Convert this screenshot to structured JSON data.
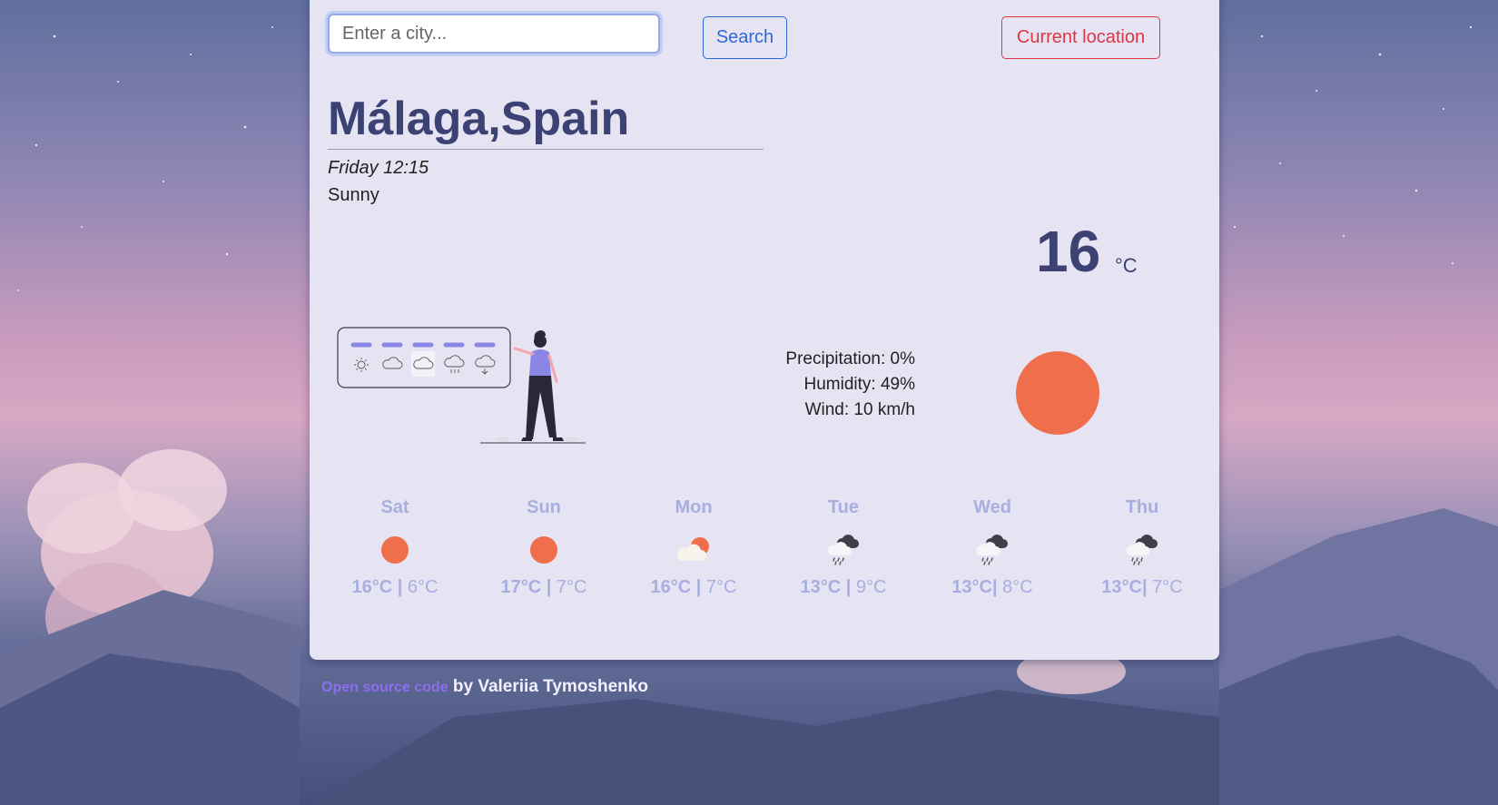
{
  "search": {
    "placeholder": "Enter a city...",
    "search_label": "Search",
    "location_label": "Current location"
  },
  "current": {
    "city": "Málaga,Spain",
    "datetime": "Friday 12:15",
    "description": "Sunny",
    "temperature": "16",
    "unit": "°C",
    "icon": "sun-icon",
    "details": {
      "precipitation": "Precipitation: 0%",
      "humidity": "Humidity: 49%",
      "wind": "Wind: 10 km/h"
    }
  },
  "forecast": [
    {
      "day": "Sat",
      "max": "16°C",
      "sep": " | ",
      "min": "6°C",
      "icon": "sun-icon"
    },
    {
      "day": "Sun",
      "max": "17°C",
      "sep": " | ",
      "min": "7°C",
      "icon": "sun-icon"
    },
    {
      "day": "Mon",
      "max": "16°C",
      "sep": " | ",
      "min": "7°C",
      "icon": "partly-cloudy-icon"
    },
    {
      "day": "Tue",
      "max": "13°C",
      "sep": " | ",
      "min": "9°C",
      "icon": "rain-cloud-icon"
    },
    {
      "day": "Wed",
      "max": "13°C",
      "sep": "| ",
      "min": "8°C",
      "icon": "rain-cloud-icon"
    },
    {
      "day": "Thu",
      "max": "13°C",
      "sep": "| ",
      "min": "7°C",
      "icon": "rain-cloud-icon"
    }
  ],
  "footer": {
    "link_label": "Open source code",
    "author": " by Valeriia Tymoshenko"
  },
  "colors": {
    "accent": "#3c4274",
    "sun": "#ef6f4c",
    "forecast_text": "#a8aee0",
    "search_button": "#2f67d8",
    "location_button": "#dc3545",
    "footer_link": "#8f6df0"
  }
}
